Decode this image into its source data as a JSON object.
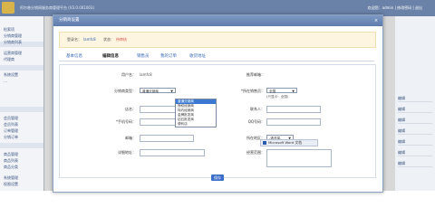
{
  "app": {
    "system_title": "阿尔普分销网服务商管理平台 (V3.0.001003)",
    "top_right": "欢迎您：admin | 修改密码 | 退出"
  },
  "sidebar": {
    "items": [
      "检索项",
      "分销商管理",
      "分销商列表",
      "",
      "运营商管理",
      "代理商",
      "",
      "系统设置",
      "…",
      "会员管理",
      "会员列表",
      "订单管理",
      "分销订单",
      "",
      "商品管理",
      "商品列表",
      "商品分类",
      "",
      "系统管理",
      "权限设置",
      "日志"
    ]
  },
  "modal": {
    "title": "分销商设置",
    "close": "×",
    "notice": {
      "label_user": "登录名：",
      "user": "lamfc8",
      "label_status": "状态：",
      "status": "待审核"
    },
    "tabs": [
      "基本信息",
      "编辑信息",
      "销售员",
      "我的订单",
      "收货地址"
    ],
    "active_tab": 1,
    "form": {
      "username_label": "用户名：",
      "username_value": "lamfc8",
      "type_label": "分销商类型：",
      "type_selected": "普通分销商",
      "type_options": [
        "普通分销商",
        "授权经销商",
        "特约经销商",
        "金牌批发商",
        "钻石批发商",
        "便利店"
      ],
      "store_label": "店名：",
      "phone_label": "*手机号码：",
      "email_label": "邮箱：",
      "address_label": "详细地址：",
      "referrer_label": "推荐邮箱：",
      "sales_label": "*所在销售员：",
      "sales_selected": "全国",
      "sales_hint": "(只显示：全国)",
      "contact_label": "联系人：",
      "qq_label": "QQ号码：",
      "region_label": "所在地区：",
      "region_selected": "-请选择-",
      "scope_label": "经营范围：",
      "autocomplete": "Microsoft Word 文档"
    },
    "save_label": "保存"
  },
  "right_pane": {
    "rows": [
      "",
      "",
      "编辑",
      "编辑",
      "编辑",
      "编辑",
      "编辑",
      "编辑",
      "编辑"
    ]
  }
}
